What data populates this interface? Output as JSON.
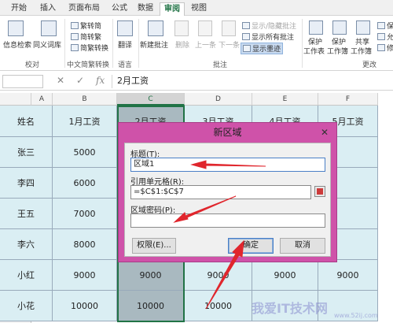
{
  "tabs": [
    "开始",
    "插入",
    "页面布局",
    "公式",
    "数据",
    "审阅",
    "视图"
  ],
  "active_tab": "审阅",
  "ribbon": {
    "proofing": {
      "spell_check": "信息检索",
      "thesaurus": "同义词库",
      "group": "校对"
    },
    "chinese": {
      "to_simplified": "繁转简",
      "to_traditional": "简转繁",
      "convert": "简繁转换",
      "group": "中文简繁转换"
    },
    "language": {
      "translate": "翻译",
      "group": "语言"
    },
    "comments": {
      "new": "新建批注",
      "delete": "删除",
      "previous": "上一条",
      "next": "下一条",
      "show_hide": "显示/隐藏批注",
      "show_all": "显示所有批注",
      "show_ink": "显示墨迹",
      "group": "批注"
    },
    "changes": {
      "protect_sheet_1": "保护",
      "protect_sheet_2": "工作表",
      "protect_book_1": "保护",
      "protect_book_2": "工作簿",
      "share_1": "共享",
      "share_2": "工作簿",
      "group": "更改",
      "cut_1": "保",
      "cut_2": "允",
      "cut_3": "修"
    }
  },
  "formula_bar": {
    "cancel": "✕",
    "enter": "✓",
    "fx": "fx",
    "value": "2月工资"
  },
  "columns": [
    "A",
    "B",
    "C",
    "D",
    "E",
    "F"
  ],
  "table": {
    "headers": [
      "姓名",
      "1月工资",
      "2月工资",
      "3月工资",
      "4月工资",
      "5月工资"
    ],
    "rows": [
      [
        "张三",
        "5000",
        "",
        "",
        "",
        ""
      ],
      [
        "李四",
        "6000",
        "",
        "",
        "",
        ""
      ],
      [
        "王五",
        "7000",
        "",
        "",
        "",
        ""
      ],
      [
        "李六",
        "8000",
        "",
        "",
        "",
        ""
      ],
      [
        "小红",
        "9000",
        "9000",
        "9000",
        "9000",
        "9000"
      ],
      [
        "小花",
        "10000",
        "10000",
        "10000",
        "",
        ""
      ]
    ]
  },
  "dialog": {
    "title": "新区域",
    "close": "✕",
    "title_label": "标题(T):",
    "title_value": "区域1",
    "ref_label": "引用单元格(R):",
    "ref_value": "=$C$1:$C$7",
    "password_label": "区域密码(P):",
    "password_value": "",
    "permissions": "权限(E)...",
    "ok": "确定",
    "cancel": "取消"
  },
  "watermark": {
    "main": "我爱IT技术网",
    "sub": "www.52ij.com"
  },
  "colors": {
    "accent": "#217346",
    "dialog_border": "#cf52a9",
    "cell_fill": "#daeef3",
    "arrow": "#e0262d"
  }
}
